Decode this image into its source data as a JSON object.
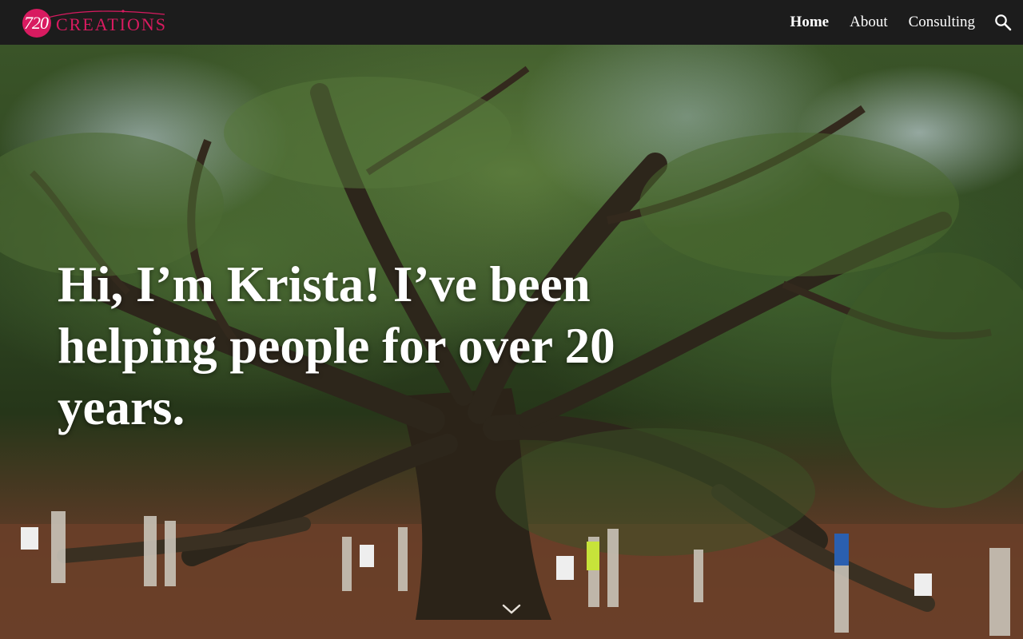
{
  "brand": {
    "logo_number": "720",
    "logo_word": "CREATIONS",
    "accent": "#d81b60"
  },
  "nav": {
    "items": [
      {
        "label": "Home",
        "active": true
      },
      {
        "label": "About",
        "active": false
      },
      {
        "label": "Consulting",
        "active": false
      }
    ],
    "search_icon": "search-icon"
  },
  "hero": {
    "title": "Hi, I’m Krista! I’ve been helping people for over 20 years.",
    "background": "photo of a giant live oak tree with visitors beneath",
    "scroll_icon": "chevron-down-icon"
  }
}
